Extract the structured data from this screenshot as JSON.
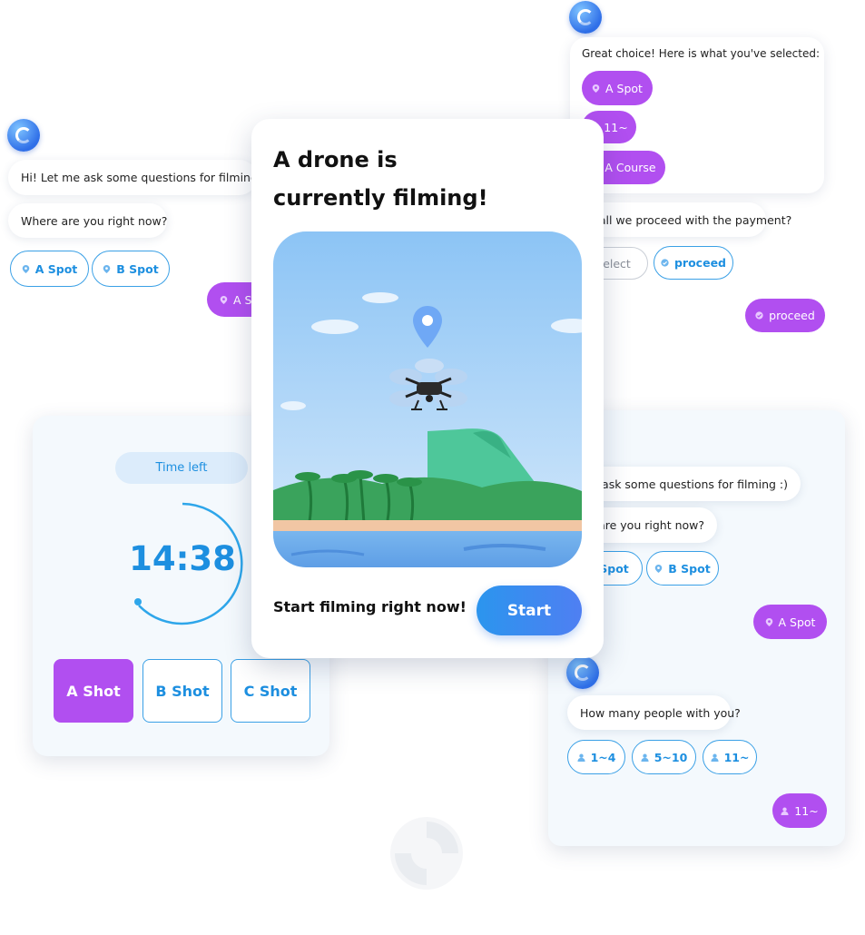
{
  "left_chat": {
    "greeting": "Hi! Let me ask some questions for filming :)",
    "question": "Where are you right now?",
    "option_a": "A Spot",
    "option_b": "B Spot",
    "selected": "A Spot"
  },
  "top_right_chat": {
    "summary_title": "Great choice! Here is what you've selected:",
    "selections": [
      "A Spot",
      "11~",
      "A Course"
    ],
    "question": "Shall we proceed with the payment?",
    "reselect_label": "reselect",
    "proceed_label": "proceed",
    "user_reply": "proceed"
  },
  "main_card": {
    "title_line1": "A drone is",
    "title_line2": "currently filming!",
    "footer_text": "Start filming right now!",
    "start_label": "Start"
  },
  "timer_card": {
    "label": "Time left",
    "time": "14:38",
    "shots": [
      "A Shot",
      "B Shot",
      "C Shot"
    ],
    "selected_shot": "A Shot"
  },
  "bottom_right_chat": {
    "greeting": "Hi! Let me ask some questions for filming :)",
    "question": "Where are you right now?",
    "option_a": "A Spot",
    "option_b": "B Spot",
    "selected": "A Spot",
    "people_question": "How many people with you?",
    "people_options": [
      "1~4",
      "5~10",
      "11~"
    ],
    "people_selected": "11~"
  },
  "colors": {
    "accent_blue": "#3a86f0",
    "accent_purple": "#b14ff0",
    "chip_blue": "#1d8fe0"
  }
}
